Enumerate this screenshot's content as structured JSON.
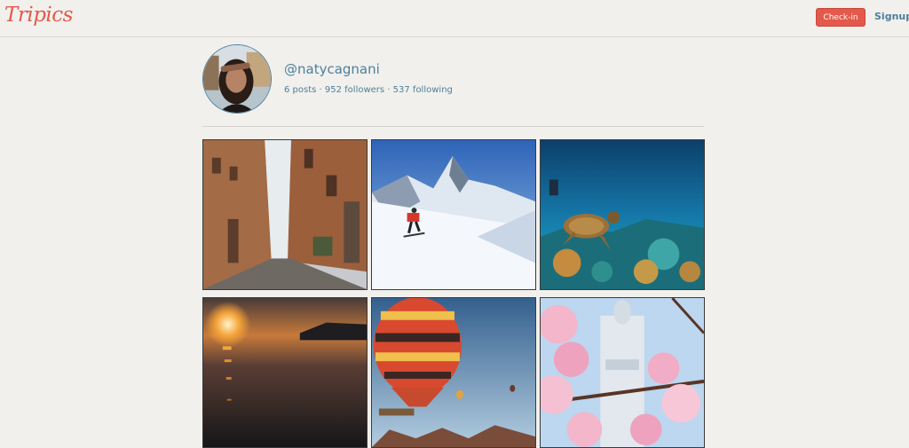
{
  "header": {
    "logo_text": "Tripics",
    "checkin_label": "Check-in",
    "signup_label": "Signup"
  },
  "profile": {
    "username": "@natycagnani",
    "stats": "6 posts · 952 followers · 537 following"
  },
  "colors": {
    "brand_red": "#e3594b",
    "link_blue": "#4d7f9c",
    "background": "#f1f0ec"
  },
  "posts": [
    {
      "subject": "narrow-street-photo"
    },
    {
      "subject": "skier-mountain-photo"
    },
    {
      "subject": "sea-turtle-reef-photo"
    },
    {
      "subject": "sunset-sea-photo"
    },
    {
      "subject": "hot-air-balloons-photo"
    },
    {
      "subject": "cherry-blossom-tower-photo"
    }
  ]
}
